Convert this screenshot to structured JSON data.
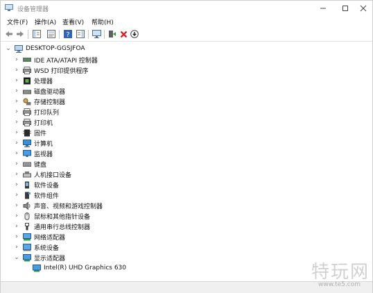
{
  "window": {
    "title": "设备管理器"
  },
  "menu": [
    "文件(F)",
    "操作(A)",
    "查看(V)",
    "帮助(H)"
  ],
  "toolbar": [
    "back-icon",
    "forward-icon",
    "properties-icon",
    "scan-icon",
    "help-icon",
    "panel-icon",
    "monitor-icon",
    "update-driver-icon",
    "uninstall-icon",
    "download-icon"
  ],
  "tree": {
    "root": "DESKTOP-GGSJFOA",
    "items": [
      "IDE ATA/ATAPI 控制器",
      "WSD 打印提供程序",
      "处理器",
      "磁盘驱动器",
      "存储控制器",
      "打印队列",
      "打印机",
      "固件",
      "计算机",
      "监视器",
      "键盘",
      "人机接口设备",
      "软件设备",
      "软件组件",
      "声音、视频和游戏控制器",
      "鼠标和其他指针设备",
      "通用串行总线控制器",
      "网络适配器",
      "系统设备",
      "显示适配器"
    ],
    "expanded_child": "Intel(R) UHD Graphics 630"
  },
  "watermark": {
    "text": "特玩网",
    "url": "www.te5.com"
  },
  "colors": {
    "accent": "#2f7fd6",
    "delete": "#d8202a",
    "green": "#2e9b3a"
  }
}
